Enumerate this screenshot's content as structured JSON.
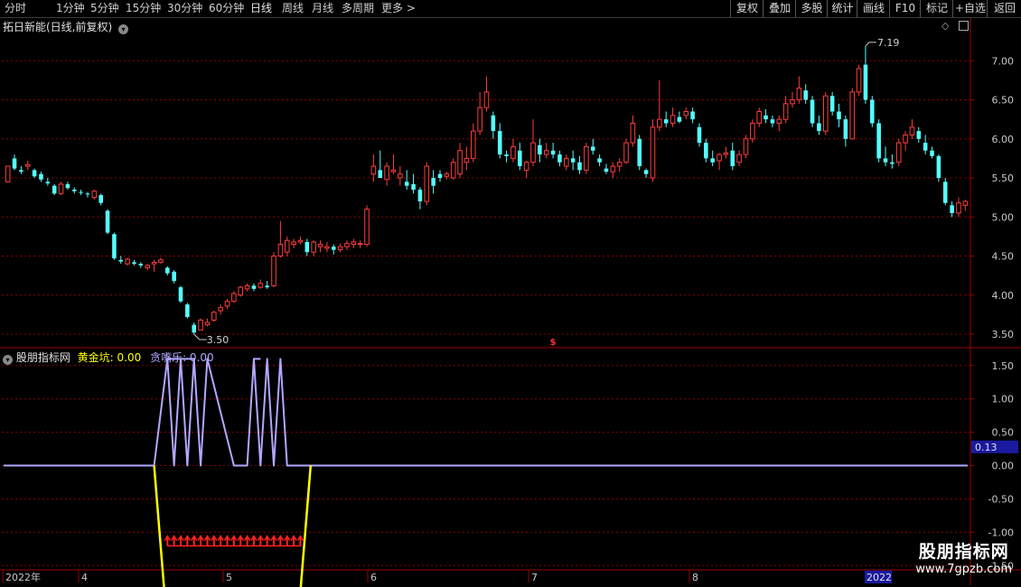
{
  "toolbar": {
    "periods": [
      "分时",
      "1分钟",
      "5分钟",
      "15分钟",
      "30分钟",
      "60分钟",
      "日线",
      "周线",
      "月线",
      "多周期",
      "更多 >"
    ],
    "active_period": "日线",
    "right_buttons": [
      "复权",
      "叠加",
      "多股",
      "统计",
      "画线",
      "F10",
      "标记",
      "+自选",
      "返回"
    ]
  },
  "main": {
    "title": "拓日新能(日线,前复权)",
    "high_label": "7.19",
    "low_label": "3.50",
    "event_marker": "$",
    "y_ticks": [
      "7.00",
      "6.50",
      "6.00",
      "5.50",
      "5.00",
      "4.50",
      "4.00",
      "3.50"
    ]
  },
  "indicator": {
    "name": "股朋指标网",
    "series1_label": "黄金坑: 0.00",
    "series2_label": "贪嘴乐: 0.00",
    "current_value_badge": "0.13",
    "y_ticks": [
      "1.50",
      "1.00",
      "0.50",
      "0.00",
      "-0.50",
      "-1.00",
      "-1.50"
    ]
  },
  "x_axis": {
    "labels": [
      "2022年",
      "4",
      "5",
      "6",
      "7",
      "8"
    ],
    "right_label": "2022"
  },
  "watermark": {
    "name": "股朋指标网",
    "url": "www.7gpzb.com"
  },
  "colors": {
    "up": "#ff3c3c",
    "down": "#54ffff",
    "gold_pit": "#ffff00",
    "greedy": "#b0a8ff",
    "arrows": "#ff2020",
    "grid": "#8b0000"
  },
  "chart_data": [
    {
      "type": "candlestick",
      "title": "拓日新能(日线,前复权)",
      "ylim": [
        3.35,
        7.35
      ],
      "y_ticks": [
        7.0,
        6.5,
        6.0,
        5.5,
        5.0,
        4.5,
        4.0,
        3.5
      ],
      "annotations": [
        {
          "label": "7.19",
          "value": 7.19
        },
        {
          "label": "3.50",
          "value": 3.5
        }
      ],
      "ohlc": [
        [
          5.45,
          5.65,
          5.45,
          5.65
        ],
        [
          5.75,
          5.8,
          5.6,
          5.62
        ],
        [
          5.6,
          5.65,
          5.55,
          5.58
        ],
        [
          5.65,
          5.72,
          5.6,
          5.67
        ],
        [
          5.6,
          5.62,
          5.5,
          5.52
        ],
        [
          5.55,
          5.58,
          5.45,
          5.48
        ],
        [
          5.45,
          5.5,
          5.4,
          5.43
        ],
        [
          5.4,
          5.42,
          5.28,
          5.3
        ],
        [
          5.3,
          5.45,
          5.28,
          5.42
        ],
        [
          5.42,
          5.45,
          5.35,
          5.37
        ],
        [
          5.35,
          5.38,
          5.3,
          5.33
        ],
        [
          5.32,
          5.35,
          5.28,
          5.31
        ],
        [
          5.3,
          5.32,
          5.25,
          5.29
        ],
        [
          5.25,
          5.35,
          5.22,
          5.33
        ],
        [
          5.28,
          5.3,
          5.15,
          5.18
        ],
        [
          5.08,
          5.1,
          4.78,
          4.8
        ],
        [
          4.78,
          4.8,
          4.45,
          4.47
        ],
        [
          4.45,
          4.5,
          4.4,
          4.43
        ],
        [
          4.4,
          4.48,
          4.38,
          4.46
        ],
        [
          4.42,
          4.45,
          4.38,
          4.4
        ],
        [
          4.4,
          4.42,
          4.35,
          4.38
        ],
        [
          4.35,
          4.4,
          4.32,
          4.38
        ],
        [
          4.4,
          4.45,
          4.3,
          4.42
        ],
        [
          4.42,
          4.48,
          4.4,
          4.45
        ],
        [
          4.35,
          4.37,
          4.25,
          4.28
        ],
        [
          4.3,
          4.32,
          4.15,
          4.18
        ],
        [
          4.1,
          4.12,
          3.9,
          3.92
        ],
        [
          3.88,
          3.9,
          3.7,
          3.72
        ],
        [
          3.62,
          3.65,
          3.5,
          3.52
        ],
        [
          3.55,
          3.7,
          3.55,
          3.68
        ],
        [
          3.62,
          3.7,
          3.6,
          3.65
        ],
        [
          3.68,
          3.8,
          3.66,
          3.78
        ],
        [
          3.8,
          3.88,
          3.75,
          3.84
        ],
        [
          3.86,
          3.95,
          3.82,
          3.92
        ],
        [
          3.92,
          4.05,
          3.9,
          4.02
        ],
        [
          4.0,
          4.12,
          3.98,
          4.1
        ],
        [
          4.08,
          4.15,
          4.05,
          4.12
        ],
        [
          4.12,
          4.15,
          4.05,
          4.08
        ],
        [
          4.1,
          4.2,
          4.08,
          4.15
        ],
        [
          4.12,
          4.18,
          4.08,
          4.1
        ],
        [
          4.12,
          4.55,
          4.1,
          4.5
        ],
        [
          4.5,
          4.95,
          4.48,
          4.65
        ],
        [
          4.55,
          4.75,
          4.5,
          4.7
        ],
        [
          4.65,
          4.72,
          4.6,
          4.68
        ],
        [
          4.68,
          4.75,
          4.65,
          4.7
        ],
        [
          4.68,
          4.72,
          4.5,
          4.55
        ],
        [
          4.55,
          4.7,
          4.5,
          4.68
        ],
        [
          4.62,
          4.7,
          4.55,
          4.65
        ],
        [
          4.6,
          4.68,
          4.55,
          4.62
        ],
        [
          4.62,
          4.65,
          4.52,
          4.58
        ],
        [
          4.58,
          4.66,
          4.55,
          4.62
        ],
        [
          4.62,
          4.7,
          4.58,
          4.66
        ],
        [
          4.65,
          4.72,
          4.6,
          4.68
        ],
        [
          4.65,
          4.7,
          4.6,
          4.66
        ],
        [
          4.65,
          5.15,
          4.62,
          5.1
        ],
        [
          5.55,
          5.8,
          5.45,
          5.65
        ],
        [
          5.6,
          5.85,
          5.5,
          5.5
        ],
        [
          5.48,
          5.7,
          5.4,
          5.65
        ],
        [
          5.58,
          5.8,
          5.55,
          5.6
        ],
        [
          5.5,
          5.65,
          5.4,
          5.55
        ],
        [
          5.45,
          5.6,
          5.35,
          5.4
        ],
        [
          5.42,
          5.55,
          5.3,
          5.35
        ],
        [
          5.35,
          5.38,
          5.1,
          5.2
        ],
        [
          5.2,
          5.7,
          5.15,
          5.65
        ],
        [
          5.5,
          5.6,
          5.3,
          5.4
        ],
        [
          5.55,
          5.6,
          5.45,
          5.5
        ],
        [
          5.52,
          5.58,
          5.48,
          5.55
        ],
        [
          5.5,
          5.75,
          5.48,
          5.7
        ],
        [
          5.55,
          5.95,
          5.5,
          5.85
        ],
        [
          5.7,
          5.9,
          5.6,
          5.75
        ],
        [
          5.75,
          6.2,
          5.7,
          6.1
        ],
        [
          6.1,
          6.6,
          6.05,
          6.4
        ],
        [
          6.4,
          6.8,
          6.35,
          6.6
        ],
        [
          6.3,
          6.35,
          6.0,
          6.1
        ],
        [
          6.1,
          6.2,
          5.75,
          5.8
        ],
        [
          5.8,
          5.85,
          5.7,
          5.78
        ],
        [
          5.75,
          6.0,
          5.7,
          5.9
        ],
        [
          5.85,
          5.95,
          5.6,
          5.65
        ],
        [
          5.6,
          5.72,
          5.5,
          5.7
        ],
        [
          5.7,
          6.25,
          5.65,
          5.95
        ],
        [
          5.92,
          6.0,
          5.7,
          5.8
        ],
        [
          5.8,
          5.95,
          5.75,
          5.85
        ],
        [
          5.85,
          5.95,
          5.75,
          5.8
        ],
        [
          5.8,
          5.85,
          5.65,
          5.7
        ],
        [
          5.65,
          5.8,
          5.6,
          5.75
        ],
        [
          5.75,
          5.85,
          5.6,
          5.7
        ],
        [
          5.7,
          5.78,
          5.55,
          5.6
        ],
        [
          5.6,
          5.95,
          5.55,
          5.9
        ],
        [
          5.9,
          6.0,
          5.8,
          5.85
        ],
        [
          5.75,
          5.8,
          5.65,
          5.7
        ],
        [
          5.62,
          5.68,
          5.55,
          5.58
        ],
        [
          5.58,
          5.7,
          5.5,
          5.65
        ],
        [
          5.65,
          5.75,
          5.58,
          5.7
        ],
        [
          5.7,
          6.0,
          5.68,
          5.95
        ],
        [
          5.95,
          6.3,
          5.9,
          6.2
        ],
        [
          6.0,
          6.05,
          5.6,
          5.65
        ],
        [
          5.6,
          5.62,
          5.5,
          5.55
        ],
        [
          5.5,
          6.25,
          5.45,
          6.15
        ],
        [
          6.15,
          6.75,
          6.1,
          6.25
        ],
        [
          6.25,
          6.35,
          6.15,
          6.2
        ],
        [
          6.2,
          6.4,
          6.15,
          6.3
        ],
        [
          6.28,
          6.35,
          6.2,
          6.22
        ],
        [
          6.3,
          6.4,
          6.25,
          6.35
        ],
        [
          6.35,
          6.4,
          6.2,
          6.25
        ],
        [
          6.15,
          6.2,
          5.9,
          5.95
        ],
        [
          5.95,
          6.0,
          5.7,
          5.75
        ],
        [
          5.75,
          5.85,
          5.65,
          5.7
        ],
        [
          5.72,
          5.82,
          5.6,
          5.8
        ],
        [
          5.8,
          5.9,
          5.75,
          5.82
        ],
        [
          5.85,
          5.95,
          5.6,
          5.65
        ],
        [
          5.7,
          5.85,
          5.65,
          5.8
        ],
        [
          5.8,
          6.05,
          5.75,
          6.0
        ],
        [
          6.0,
          6.25,
          5.95,
          6.2
        ],
        [
          6.2,
          6.4,
          6.15,
          6.35
        ],
        [
          6.3,
          6.38,
          6.2,
          6.25
        ],
        [
          6.25,
          6.3,
          6.15,
          6.2
        ],
        [
          6.2,
          6.3,
          6.1,
          6.25
        ],
        [
          6.25,
          6.55,
          6.2,
          6.45
        ],
        [
          6.45,
          6.6,
          6.4,
          6.5
        ],
        [
          6.5,
          6.8,
          6.45,
          6.65
        ],
        [
          6.62,
          6.7,
          6.45,
          6.5
        ],
        [
          6.5,
          6.55,
          6.15,
          6.2
        ],
        [
          6.2,
          6.3,
          6.05,
          6.1
        ],
        [
          6.1,
          6.6,
          6.05,
          6.55
        ],
        [
          6.55,
          6.6,
          6.3,
          6.35
        ],
        [
          6.35,
          6.45,
          6.15,
          6.25
        ],
        [
          6.25,
          6.3,
          5.9,
          6.0
        ],
        [
          6.0,
          6.65,
          6.0,
          6.6
        ],
        [
          6.6,
          6.95,
          6.55,
          6.9
        ],
        [
          6.95,
          7.19,
          6.45,
          6.5
        ],
        [
          6.5,
          6.55,
          6.15,
          6.2
        ],
        [
          6.2,
          6.25,
          5.7,
          5.75
        ],
        [
          5.75,
          5.9,
          5.65,
          5.7
        ],
        [
          5.7,
          5.8,
          5.62,
          5.68
        ],
        [
          5.7,
          6.0,
          5.65,
          5.95
        ],
        [
          5.95,
          6.1,
          5.85,
          6.05
        ],
        [
          6.05,
          6.25,
          6.0,
          6.15
        ],
        [
          6.1,
          6.15,
          5.95,
          6.0
        ],
        [
          5.95,
          6.05,
          5.8,
          5.85
        ],
        [
          5.85,
          5.9,
          5.75,
          5.78
        ],
        [
          5.78,
          5.8,
          5.45,
          5.5
        ],
        [
          5.45,
          5.5,
          5.15,
          5.18
        ],
        [
          5.15,
          5.2,
          5.0,
          5.05
        ],
        [
          5.05,
          5.25,
          5.0,
          5.18
        ],
        [
          5.15,
          5.22,
          5.08,
          5.2
        ]
      ]
    },
    {
      "type": "line",
      "title": "股朋指标网",
      "ylim": [
        -1.55,
        1.7
      ],
      "y_ticks": [
        1.5,
        1.0,
        0.5,
        0.0,
        -0.5,
        -1.0,
        -1.5
      ],
      "series": [
        {
          "name": "黄金坑",
          "segments": [
            [
              [
                0,
                0
              ],
              [
                1,
                -2
              ],
              [
                2,
                -2
              ],
              [
                3,
                0
              ]
            ]
          ]
        },
        {
          "name": "贪嘴乐",
          "values_note": "pulses to 1.6"
        }
      ],
      "current_badge": 0.13
    }
  ]
}
